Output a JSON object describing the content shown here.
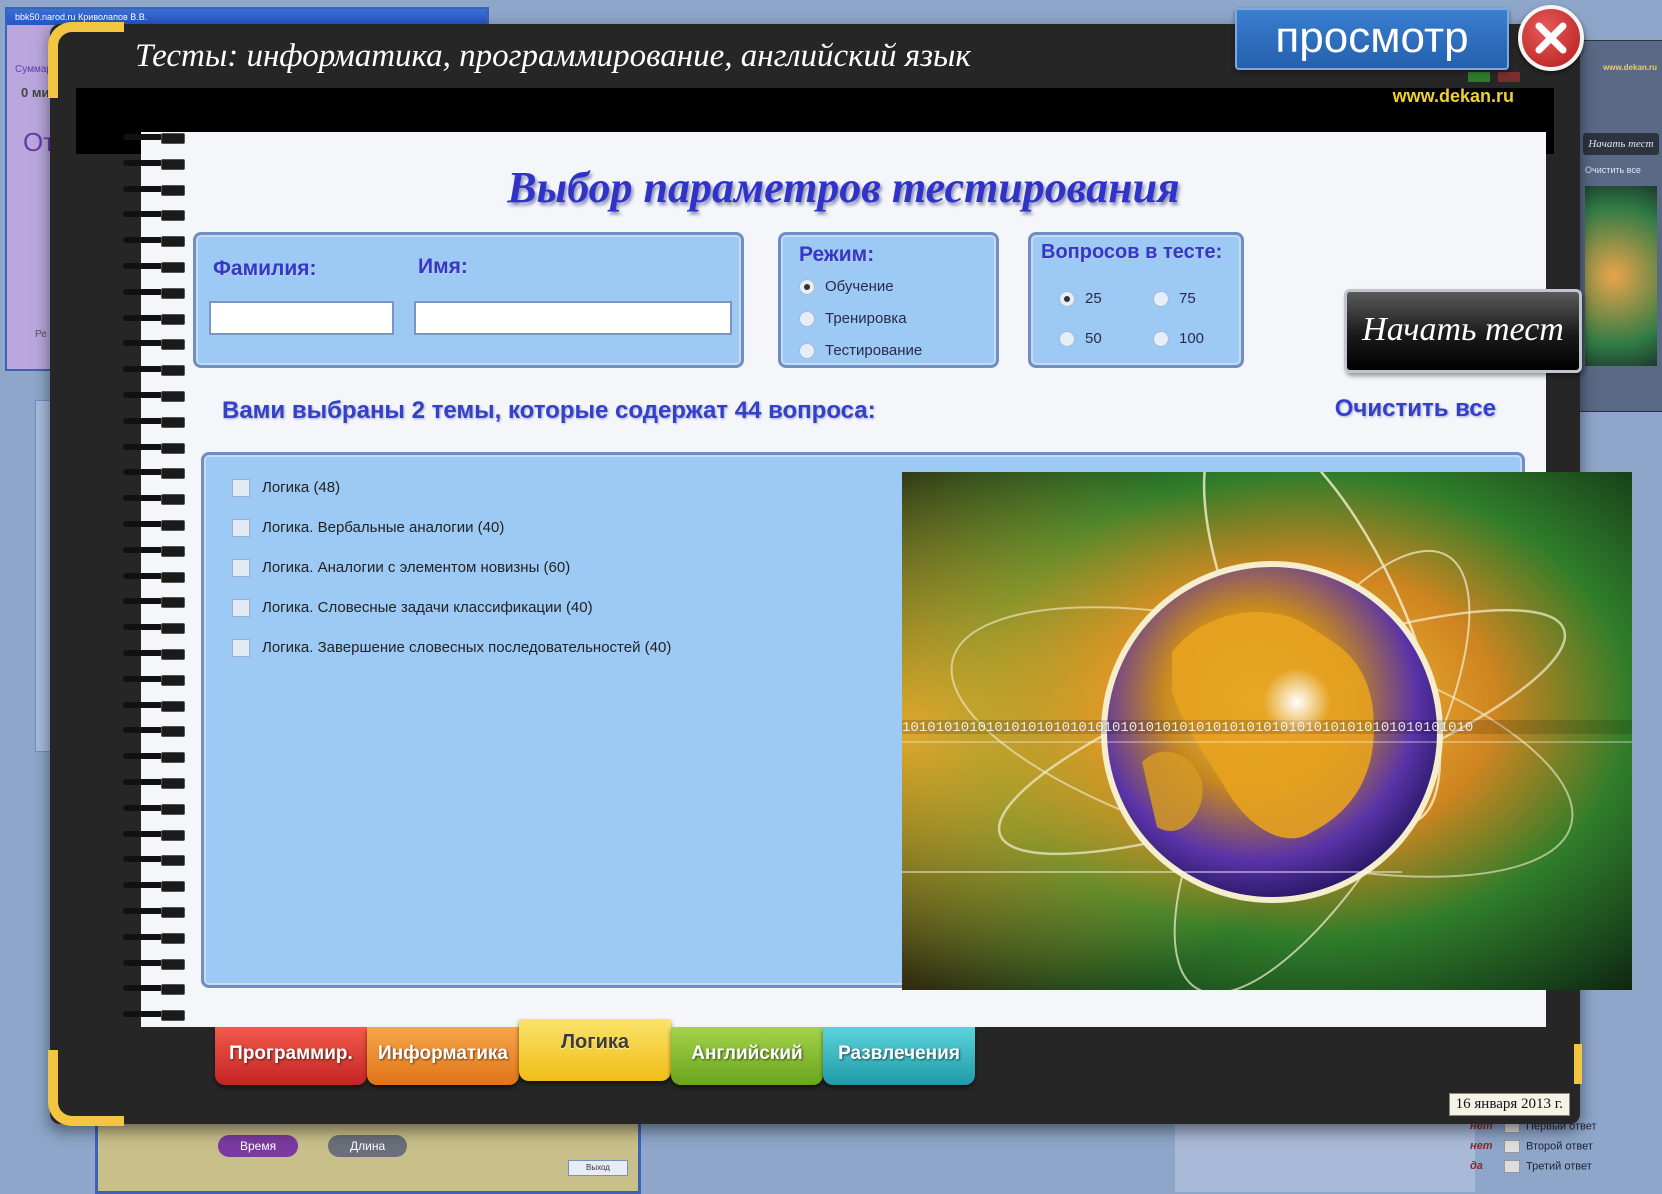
{
  "background": {
    "left_window": {
      "title": "bbk50.narod.ru  Криволапов В.В.",
      "label_1": "Суммарн",
      "label_2": "0 ми",
      "label_3": "От",
      "label_4": "Ре"
    },
    "bottom_window": {
      "pills": [
        "Время",
        "Длина"
      ],
      "exit_label": "Выход"
    },
    "right_window": {
      "url": "www.dekan.ru",
      "start_label": "Начать тест",
      "clear_label": "Очистить все"
    },
    "answers": [
      {
        "key": "нет",
        "label": "Первый ответ"
      },
      {
        "key": "нет",
        "label": "Второй ответ"
      },
      {
        "key": "да",
        "label": "Третий ответ"
      }
    ]
  },
  "app": {
    "title": "Тесты:  информатика, программирование, английский язык",
    "url": "www.dekan.ru",
    "heading": "Выбор параметров тестирования"
  },
  "name_form": {
    "surname_label": "Фамилия:",
    "surname_value": "",
    "name_label": "Имя:",
    "name_value": ""
  },
  "mode": {
    "label": "Режим:",
    "options": [
      "Обучение",
      "Тренировка",
      "Тестирование"
    ],
    "selected": "Обучение"
  },
  "questions": {
    "label": "Вопросов в тесте:",
    "options": [
      "25",
      "75",
      "50",
      "100"
    ],
    "selected": "25"
  },
  "start_button": "Начать тест",
  "summary": "Вами выбраны 2 темы, которые содержат 44 вопроса:",
  "clear_all": "Очистить все",
  "topics": [
    "Логика (48)",
    "Логика. Вербальные аналогии (40)",
    "Логика. Аналогии с элементом новизны (60)",
    "Логика. Словесные задачи классификации (40)",
    "Логика. Завершение словесных последовательностей (40)"
  ],
  "image": {
    "binary_text": "10101010101010101010101010101010101010101010101010101010101010101010"
  },
  "tabs": [
    {
      "label": "Программир.",
      "color": "#e23a3a"
    },
    {
      "label": "Информатика",
      "color": "#f08a28"
    },
    {
      "label": "Логика",
      "color": "#f3c81f"
    },
    {
      "label": "Английский",
      "color": "#7dbb2a"
    },
    {
      "label": "Развлечения",
      "color": "#2cb5c0"
    }
  ],
  "active_tab": "Логика",
  "date": "16 января 2013 г.",
  "preview_label": "просмотр",
  "colors": {
    "accent_text": "#3338c9",
    "panel": "#9ccaf4",
    "frame": "#262626",
    "gold": "#f2c640",
    "url": "#f0d12c"
  }
}
